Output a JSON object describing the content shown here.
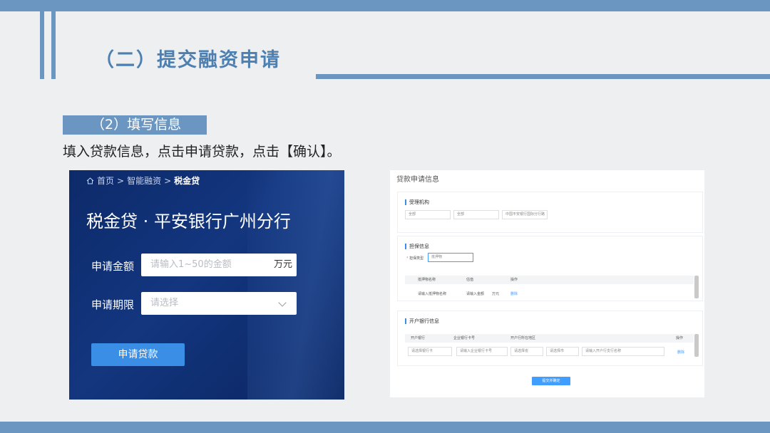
{
  "slide": {
    "title": "（二）提交融资申请",
    "section_tag": "（2）填写信息",
    "instruction": "填入贷款信息，点击申请贷款，点击【确认】。"
  },
  "left_panel": {
    "breadcrumb": [
      "首页",
      "智能融资",
      "税金贷"
    ],
    "breadcrumb_sep": ">",
    "product_title": "税金贷 · 平安银行广州分行",
    "amount_label": "申请金额",
    "amount_placeholder": "请输入1~50的金额",
    "amount_unit": "万元",
    "term_label": "申请期限",
    "term_placeholder": "请选择",
    "apply_button": "申请贷款"
  },
  "right_panel": {
    "title": "贷款申请信息",
    "org_section": {
      "title": "受理机构",
      "selects": [
        "全部",
        "全部",
        "中国平安银行国际分行路"
      ]
    },
    "guarantee_section": {
      "title": "担保信息",
      "type_label": "担保类型",
      "type_value": "抵押物",
      "columns": [
        "抵押物名称",
        "估值",
        "操作"
      ],
      "row": {
        "name": "请输入抵押物名称",
        "value": "请输入金额",
        "unit": "万元",
        "action": "删除"
      }
    },
    "bank_section": {
      "title": "开户银行信息",
      "columns": [
        "开户银行",
        "企业银行卡号",
        "开户行所在地区",
        "操作"
      ],
      "row": {
        "bank": "请选择银行卡",
        "card": "请输入企业银行卡号",
        "province": "请选择省",
        "city": "请选择市",
        "branch": "请输入开户行支行名称",
        "action": "删除"
      }
    },
    "save_button": "提交并确定"
  },
  "colors": {
    "accent_bar": "#6b96c2",
    "title_text": "#4d7fb1",
    "panel_dark": "#13367f",
    "button_blue": "#3a8ee6"
  }
}
